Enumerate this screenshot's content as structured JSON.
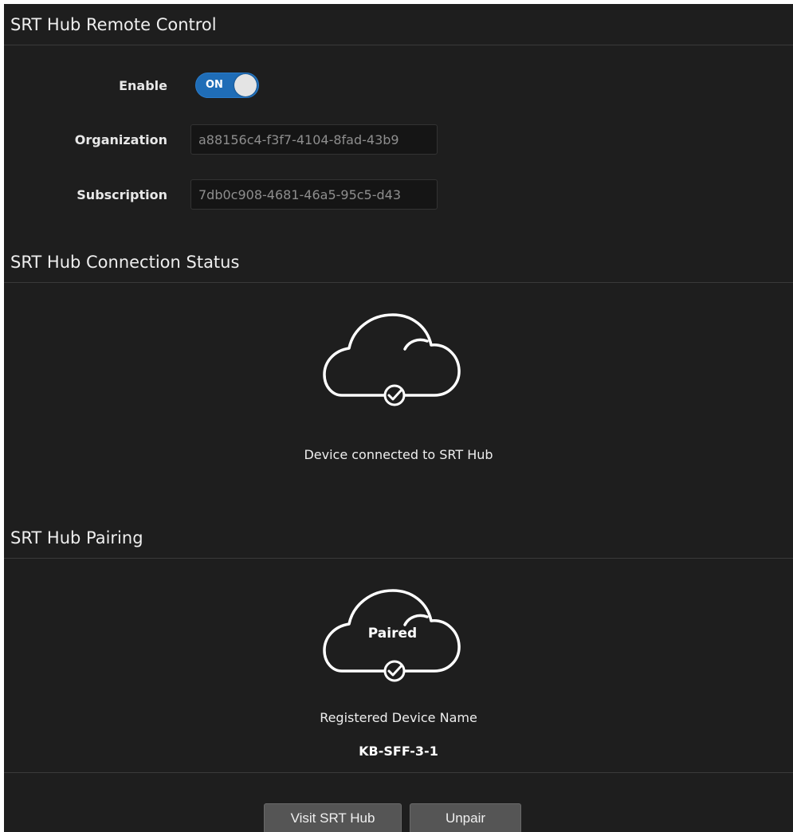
{
  "remote_control": {
    "title": "SRT Hub Remote Control",
    "enable_label": "Enable",
    "enable_toggle_text": "ON",
    "enable_state": true,
    "organization_label": "Organization",
    "organization_value": "a88156c4-f3f7-4104-8fad-43b9",
    "subscription_label": "Subscription",
    "subscription_value": "7db0c908-4681-46a5-95c5-d43"
  },
  "connection_status": {
    "title": "SRT Hub Connection Status",
    "icon": "cloud-check-icon",
    "status_text": "Device connected to SRT Hub"
  },
  "pairing": {
    "title": "SRT Hub Pairing",
    "icon": "cloud-check-icon",
    "cloud_label": "Paired",
    "registered_label": "Registered Device Name",
    "device_name": "KB-SFF-3-1"
  },
  "actions": {
    "visit_label": "Visit SRT Hub",
    "unpair_label": "Unpair"
  },
  "colors": {
    "panel_bg": "#1e1e1e",
    "toggle_on": "#1f6db7",
    "button_bg": "#555555"
  }
}
